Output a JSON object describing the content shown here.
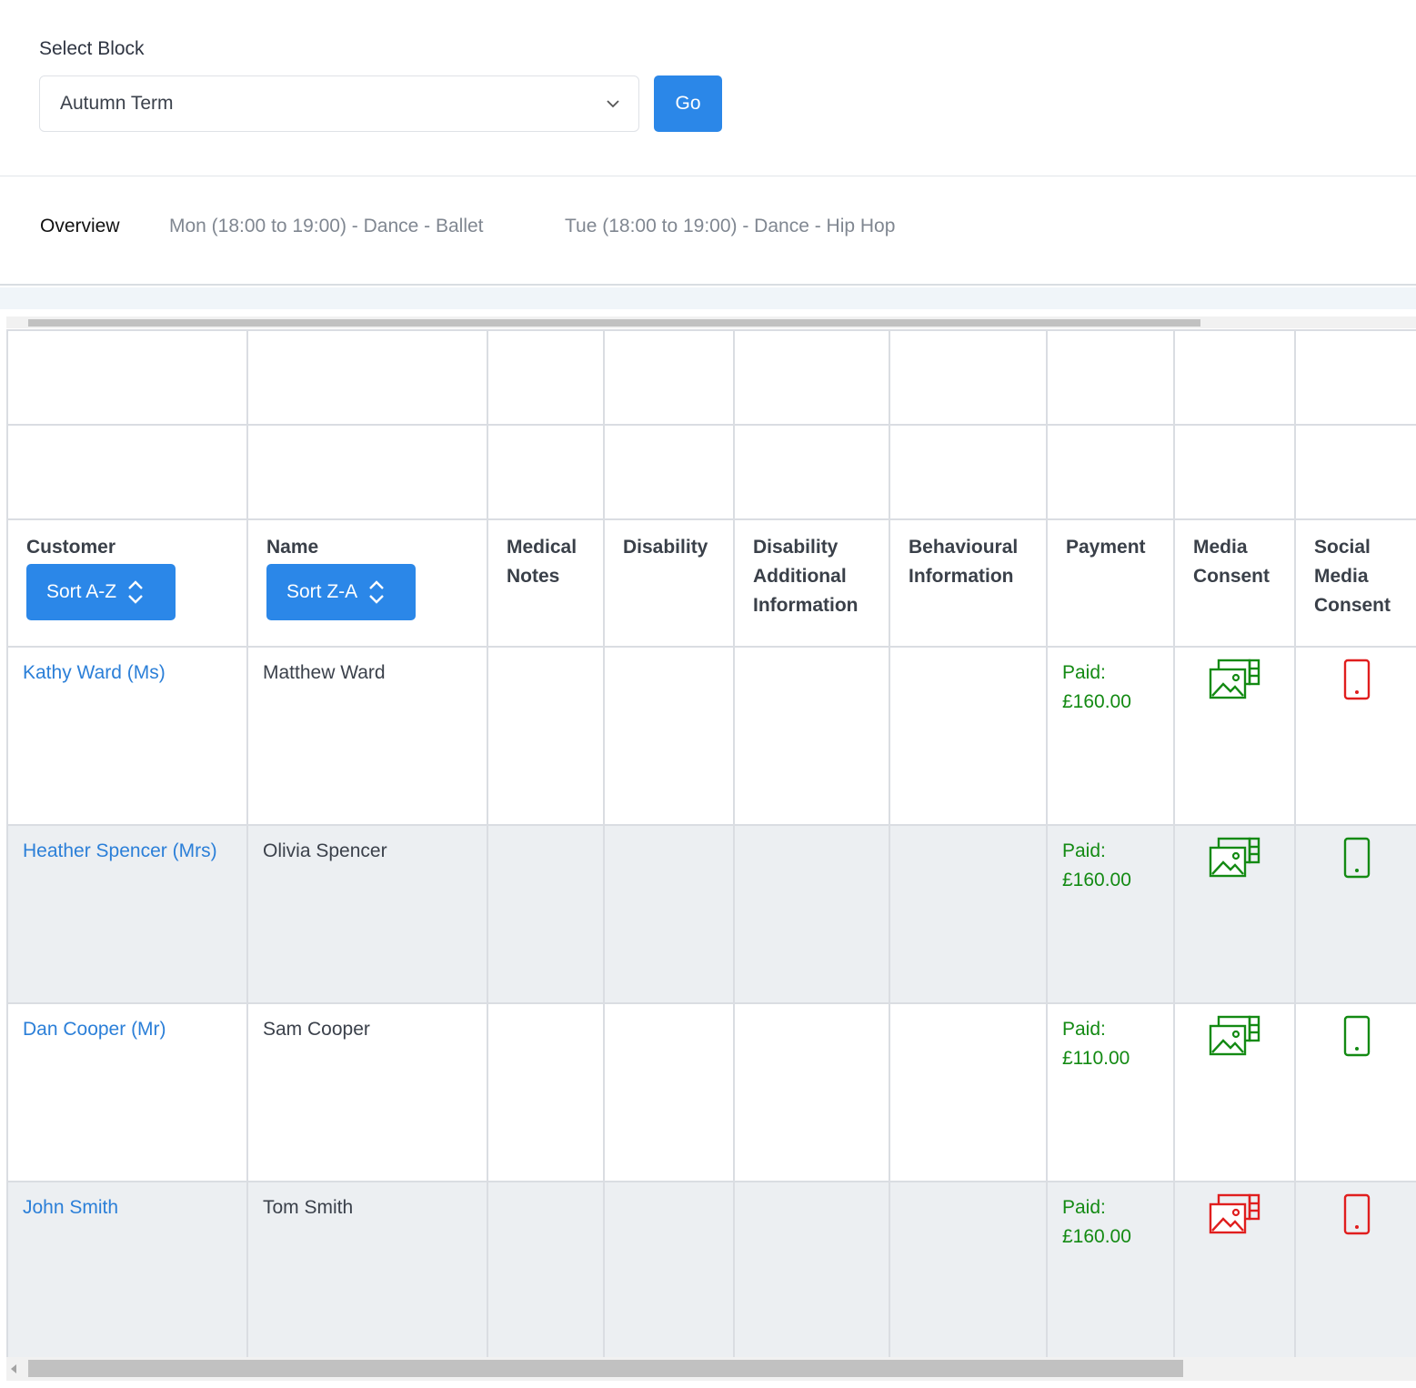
{
  "block_select": {
    "label": "Select Block",
    "selected_value": "Autumn Term",
    "go_label": "Go"
  },
  "tabs": [
    {
      "label": "Overview",
      "active": true
    },
    {
      "label": "Mon (18:00 to 19:00) - Dance - Ballet",
      "active": false
    },
    {
      "label": "Tue (18:00 to 19:00) - Dance - Hip Hop",
      "active": false
    }
  ],
  "table": {
    "headers": {
      "customer": "Customer",
      "customer_sort": "Sort A-Z",
      "name": "Name",
      "name_sort": "Sort Z-A",
      "medical": "Medical Notes",
      "disability": "Disability",
      "disability_additional": "Disability Additional Information",
      "behavioural": "Behavioural Information",
      "payment": "Payment",
      "media_consent": "Media Consent",
      "social_media_consent": "Social Media Consent"
    },
    "rows": [
      {
        "customer": "Kathy Ward (Ms)",
        "name": "Matthew Ward",
        "payment_label": "Paid:",
        "payment_amount": "£160.00",
        "media_consent": "granted",
        "social_media_consent": "denied"
      },
      {
        "customer": "Heather Spencer (Mrs)",
        "name": "Olivia Spencer",
        "payment_label": "Paid:",
        "payment_amount": "£160.00",
        "media_consent": "granted",
        "social_media_consent": "granted"
      },
      {
        "customer": "Dan Cooper (Mr)",
        "name": "Sam Cooper",
        "payment_label": "Paid:",
        "payment_amount": "£110.00",
        "media_consent": "granted",
        "social_media_consent": "granted"
      },
      {
        "customer": "John Smith",
        "name": "Tom Smith",
        "payment_label": "Paid:",
        "payment_amount": "£160.00",
        "media_consent": "denied",
        "social_media_consent": "denied"
      }
    ]
  },
  "colors": {
    "accent": "#2b87e8",
    "link": "#2b7fd8",
    "granted": "#138a13",
    "denied": "#e01e1e"
  },
  "icons": {
    "media_consent": "media-gallery-icon",
    "social_media_consent": "mobile-phone-icon",
    "sort": "sort-updown-icon",
    "select": "chevron-down-icon"
  }
}
